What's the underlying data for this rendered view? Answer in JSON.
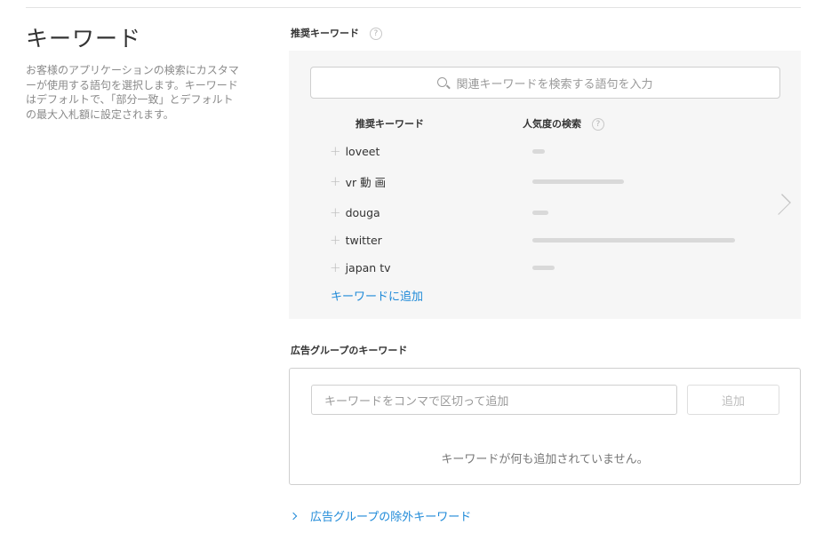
{
  "keywords_section": {
    "title": "キーワード",
    "description": "お客様のアプリケーションの検索にカスタマーが使用する語句を選択します。キーワードはデフォルトで、「部分一致」とデフォルトの最大入札額に設定されます。"
  },
  "suggested": {
    "label": "推奨キーワード",
    "help_glyph": "?",
    "search_placeholder": "関連キーワードを検索する語句を入力",
    "col_keyword": "推奨キーワード",
    "col_popularity": "人気度の検索",
    "plus_glyph": "+",
    "rows": [
      {
        "keyword": "loveet",
        "popularity": 0.06
      },
      {
        "keyword": "vr 動 画",
        "popularity": 0.45
      },
      {
        "keyword": "douga",
        "popularity": 0.08
      },
      {
        "keyword": "twitter",
        "popularity": 1.0
      },
      {
        "keyword": "japan tv",
        "popularity": 0.11
      }
    ],
    "add_link": "キーワードに追加",
    "next_icon": "chevron-right-icon"
  },
  "adgroup": {
    "label": "広告グループのキーワード",
    "input_placeholder": "キーワードをコンマで区切って追加",
    "add_button": "追加",
    "empty_message": "キーワードが何も追加されていません。"
  },
  "negative": {
    "link_label": "広告グループの除外キーワード"
  },
  "colors": {
    "accent": "#1f8ad8",
    "panel_bg": "#f6f6f6",
    "bar": "#d9d9d9"
  }
}
